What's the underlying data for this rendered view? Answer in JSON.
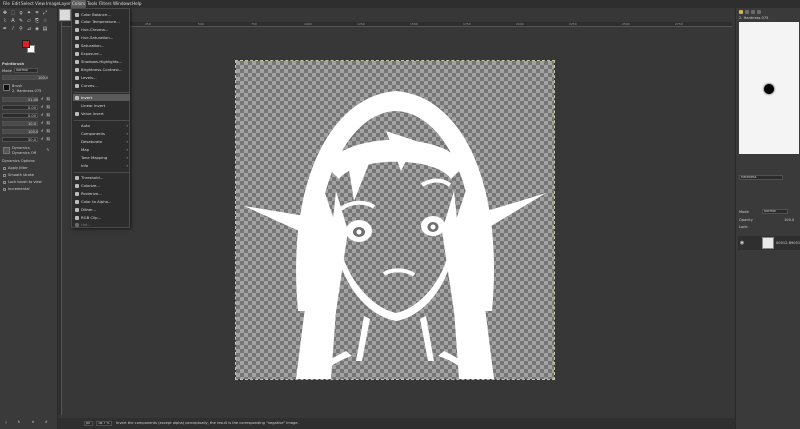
{
  "menubar": {
    "items": [
      "File",
      "Edit",
      "Select",
      "View",
      "Image",
      "Layer",
      "Colors",
      "Tools",
      "Filters",
      "Windows",
      "Help"
    ],
    "active": "Colors"
  },
  "colors_menu": {
    "items": [
      {
        "label": "Color Balance...",
        "submenu": false
      },
      {
        "label": "Color Temperature...",
        "submenu": false
      },
      {
        "label": "Hue-Chroma...",
        "submenu": false
      },
      {
        "label": "Hue-Saturation...",
        "submenu": false
      },
      {
        "label": "Saturation...",
        "submenu": false
      },
      {
        "label": "Exposure...",
        "submenu": false
      },
      {
        "label": "Shadows-Highlights...",
        "submenu": false
      },
      {
        "label": "Brightness-Contrast...",
        "submenu": false
      },
      {
        "label": "Levels...",
        "submenu": false
      },
      {
        "label": "Curves...",
        "submenu": false
      },
      {
        "label": "Invert",
        "submenu": false,
        "highlighted": true
      },
      {
        "label": "Linear Invert",
        "submenu": false
      },
      {
        "label": "Value Invert",
        "submenu": false
      },
      {
        "label": "Auto",
        "submenu": true
      },
      {
        "label": "Components",
        "submenu": true
      },
      {
        "label": "Desaturate",
        "submenu": true
      },
      {
        "label": "Map",
        "submenu": true
      },
      {
        "label": "Tone Mapping",
        "submenu": true
      },
      {
        "label": "Info",
        "submenu": true
      },
      {
        "label": "Threshold...",
        "submenu": false
      },
      {
        "label": "Colorize...",
        "submenu": false
      },
      {
        "label": "Posterize...",
        "submenu": false
      },
      {
        "label": "Color to Alpha...",
        "submenu": false
      },
      {
        "label": "Dither...",
        "submenu": false
      },
      {
        "label": "RGB Clip...",
        "submenu": false
      },
      {
        "label": "Hot...",
        "submenu": false,
        "disabled": true
      }
    ]
  },
  "tool_options": {
    "title": "Paintbrush",
    "mode_label": "Mode",
    "mode_value": "Normal",
    "opacity_label": "Opacity",
    "opacity_value": "100.0",
    "brush_label": "Brush",
    "brush_value": "2. Hardness 075",
    "size_label": "Size",
    "size_value": "51.00",
    "aspect_label": "Aspect Ratio",
    "aspect_value": "0.00",
    "angle_label": "Angle",
    "angle_value": "0.00",
    "spacing_label": "Spacing",
    "spacing_value": "10.0",
    "hardness_label": "Hardness",
    "hardness_value": "100.0",
    "force_label": "Force",
    "force_value": "50.0",
    "dynamics_label": "Dynamics",
    "dynamics_value": "Dynamics Off",
    "options": [
      "Dynamics Options",
      "Apply Jitter",
      "Smooth stroke",
      "Lock brush to view",
      "Incremental"
    ]
  },
  "right_dock": {
    "brush_name": "2. Hardness 075",
    "preset_value": "Hardness",
    "layers_mode": "Normal",
    "layers_opacity_label": "Opacity",
    "layers_opacity_value": "100.0",
    "lock_label": "Lock:",
    "layer_name": "00012-890513"
  },
  "statusbar": {
    "unit": "px",
    "zoom": "16.7 %",
    "message": "Invert the components (except alpha) perceptually, the result is the corresponding \"negative\" image."
  },
  "ruler": {
    "labels": [
      "250",
      "500",
      "750",
      "1000",
      "1250",
      "1500",
      "1750",
      "2000",
      "2250",
      "2500",
      "2750"
    ]
  },
  "colors": {
    "foreground": "#e02020",
    "background": "#ffffff",
    "menu_highlight": "#5a5a5a",
    "workspace": "#3c3c3c"
  },
  "icons": [
    "move-tool-icon",
    "rect-select-icon",
    "lasso-icon",
    "fuzzy-select-icon",
    "crop-icon",
    "unified-transform-icon",
    "warp-icon",
    "text-icon",
    "paintbrush-icon",
    "eraser-icon",
    "clone-icon",
    "smudge-icon",
    "path-icon",
    "color-picker-icon",
    "zoom-icon",
    "measure-icon",
    "bucket-fill-icon",
    "gradient-icon",
    "eye-icon"
  ]
}
